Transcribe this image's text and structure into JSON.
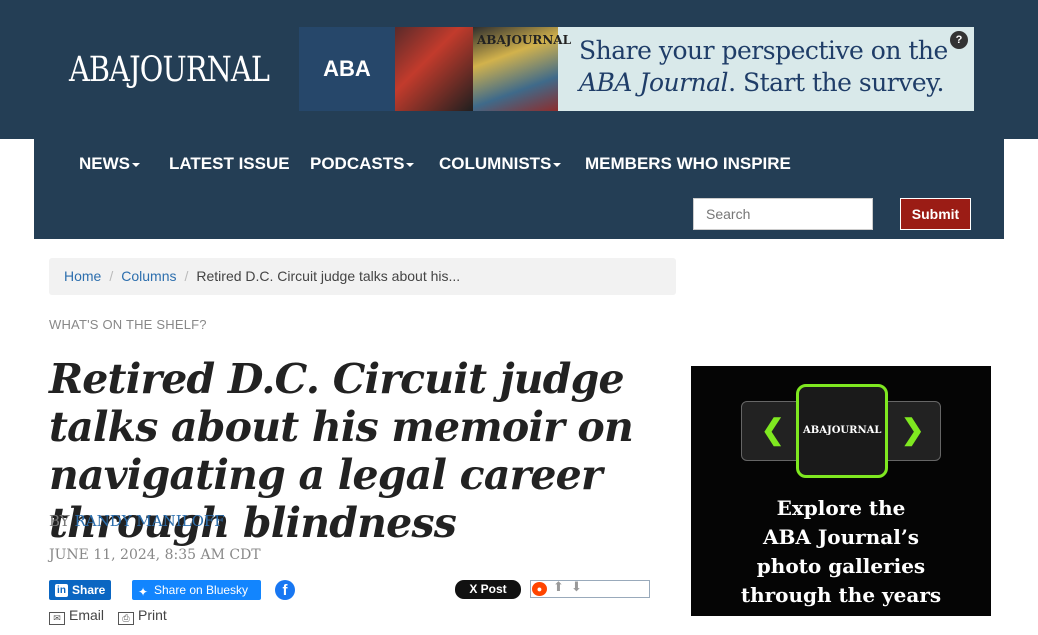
{
  "header": {
    "logo_text": "ABAJOURNAL",
    "ad_banner": {
      "logo_text": "ABA",
      "magazine_text": "ABAJOURNAL",
      "line1": "Share your perspective on the",
      "line2_em": "ABA Journal",
      "line2_rest": ". Start the survey.",
      "help_label": "?"
    }
  },
  "nav": {
    "items": [
      {
        "label": "NEWS",
        "has_dropdown": true
      },
      {
        "label": "LATEST ISSUE",
        "has_dropdown": false
      },
      {
        "label": "PODCASTS",
        "has_dropdown": true
      },
      {
        "label": "COLUMNISTS",
        "has_dropdown": true
      },
      {
        "label": "MEMBERS WHO INSPIRE",
        "has_dropdown": false
      }
    ],
    "search_placeholder": "Search",
    "submit_label": "Submit"
  },
  "breadcrumb": {
    "home": "Home",
    "section": "Columns",
    "current": "Retired D.C. Circuit judge talks about his..."
  },
  "article": {
    "kicker": "WHAT'S ON THE SHELF?",
    "title": "Retired D.C. Circuit judge talks about his memoir on navigating a legal career through blindness",
    "byline_prefix": "BY",
    "author": "RANDY MANILOFF",
    "date": "JUNE 11, 2024, 8:35 AM CDT"
  },
  "share": {
    "linkedin_label": "Share",
    "bluesky_label": "Share on Bluesky",
    "facebook_glyph": "f",
    "x_label": "X Post",
    "email_label": "Email",
    "print_label": "Print"
  },
  "side_ad": {
    "frame_label": "ABAJOURNAL",
    "text_lines": [
      "Explore the",
      "ABA Journal’s",
      "photo galleries",
      "through the years"
    ]
  },
  "colors": {
    "header_bg": "#243e55",
    "submit_bg": "#9b1c15",
    "link": "#2d6fae",
    "accent_green": "#7fe820"
  }
}
